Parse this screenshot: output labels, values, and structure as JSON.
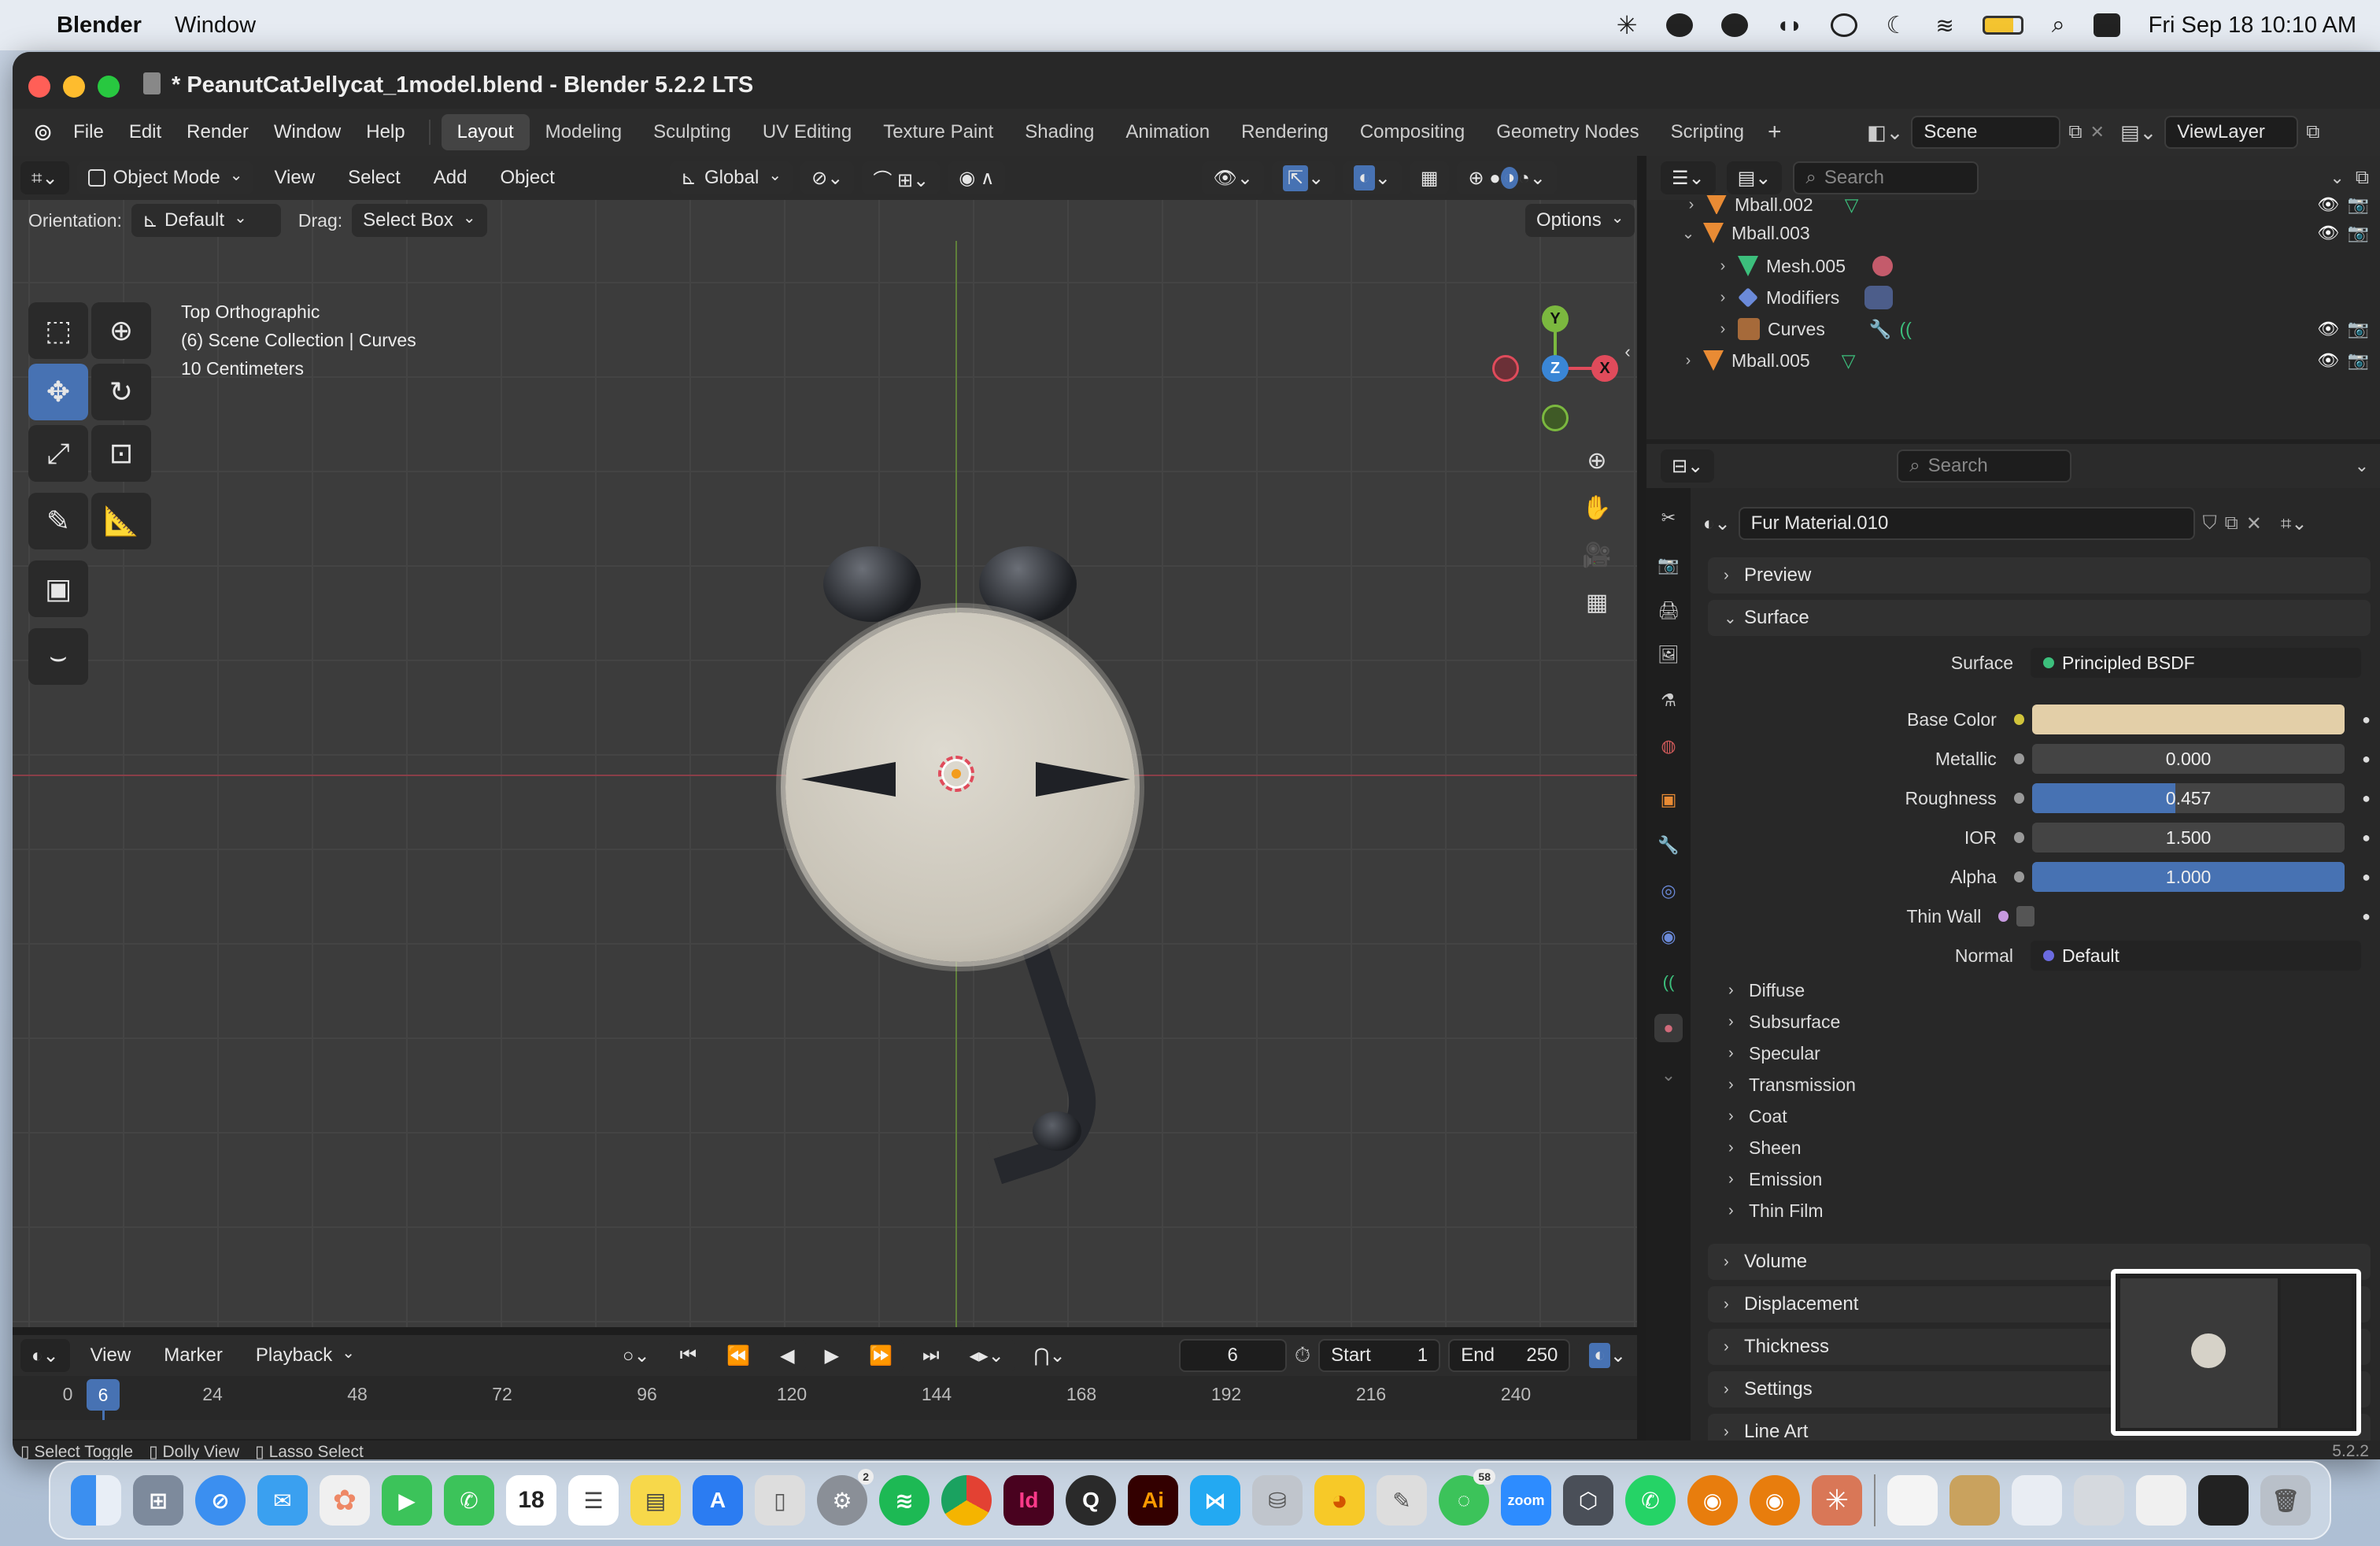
{
  "macos": {
    "app_name": "Blender",
    "menus": [
      "Window"
    ],
    "clock": "Fri Sep 18  10:10 AM"
  },
  "window": {
    "title": "* PeanutCatJellycat_1model.blend - Blender 5.2.2 LTS",
    "menus": [
      "File",
      "Edit",
      "Render",
      "Window",
      "Help"
    ],
    "workspaces": [
      "Layout",
      "Modeling",
      "Sculpting",
      "UV Editing",
      "Texture Paint",
      "Shading",
      "Animation",
      "Rendering",
      "Compositing",
      "Geometry Nodes",
      "Scripting"
    ],
    "active_workspace": "Layout",
    "scene": "Scene",
    "view_layer": "ViewLayer"
  },
  "viewport": {
    "mode": "Object Mode",
    "menus": [
      "View",
      "Select",
      "Add",
      "Object"
    ],
    "transform": "Global",
    "orientation_label": "Orientation:",
    "orientation": "Default",
    "drag_label": "Drag:",
    "drag": "Select Box",
    "options": "Options",
    "overlay_lines": [
      "Top Orthographic",
      "(6) Scene Collection | Curves",
      "10 Centimeters"
    ],
    "gizmo": {
      "y": "Y",
      "z": "Z",
      "x": "X"
    }
  },
  "outliner": {
    "search_placeholder": "Search",
    "rows": [
      {
        "label": "Mball.002",
        "indent": 0
      },
      {
        "label": "Mball.003",
        "indent": 0
      },
      {
        "label": "Mesh.005",
        "indent": 1
      },
      {
        "label": "Modifiers",
        "indent": 1
      },
      {
        "label": "Curves",
        "indent": 1
      },
      {
        "label": "Mball.005",
        "indent": 0
      }
    ]
  },
  "properties": {
    "search_placeholder": "Search",
    "material": "Fur Material.010",
    "panels": {
      "preview": "Preview",
      "surface": "Surface"
    },
    "surface": {
      "label": "Surface",
      "shader": "Principled BSDF"
    },
    "fields": {
      "base_color": {
        "label": "Base Color",
        "color": "#e3cfa8"
      },
      "metallic": {
        "label": "Metallic",
        "value": "0.000",
        "fraction": 0
      },
      "roughness": {
        "label": "Roughness",
        "value": "0.457",
        "fraction": 0.457
      },
      "ior": {
        "label": "IOR",
        "value": "1.500",
        "fraction": 0
      },
      "alpha": {
        "label": "Alpha",
        "value": "1.000",
        "fraction": 1
      },
      "thin_wall": {
        "label": "Thin Wall"
      },
      "normal": {
        "label": "Normal",
        "value": "Default"
      }
    },
    "subpanels": [
      "Diffuse",
      "Subsurface",
      "Specular",
      "Transmission",
      "Coat",
      "Sheen",
      "Emission",
      "Thin Film"
    ],
    "bottom_panels": [
      "Volume",
      "Displacement",
      "Thickness",
      "Settings",
      "Line Art",
      "Viewport Display"
    ]
  },
  "timeline": {
    "menus": [
      "View",
      "Marker",
      "Playback"
    ],
    "current_frame": "6",
    "start_label": "Start",
    "start": "1",
    "end_label": "End",
    "end": "250",
    "ruler": [
      "0",
      "6",
      "24",
      "48",
      "72",
      "96",
      "120",
      "144",
      "168",
      "192",
      "216",
      "240"
    ]
  },
  "status": {
    "items": [
      "Select Toggle",
      "Dolly View",
      "Lasso Select"
    ],
    "version": "5.2.2"
  },
  "dock": {
    "icons": [
      "finder",
      "launchpad",
      "safari",
      "mail",
      "photos",
      "facetime",
      "phone",
      "calendar",
      "reminders",
      "notes",
      "app-store",
      "files",
      "settings",
      "spotify",
      "chrome",
      "indesign",
      "quicktime",
      "illustrator",
      "vscode",
      "disk-utility",
      "cyberduck",
      "script-editor",
      "messages",
      "zoom",
      "package",
      "whatsapp",
      "blender",
      "blender-2",
      "claude",
      "preview",
      "doc-1",
      "doc-2",
      "doc-3",
      "doc-4",
      "screen-recording",
      "trash"
    ],
    "calendar_day": "18",
    "settings_badge": "2",
    "messages_badge": "58",
    "zoom_label": "zoom",
    "id_label": "Id",
    "ai_label": "Ai"
  },
  "colors": {
    "accent": "#4772b3",
    "axis_x": "#e04b5b",
    "axis_y": "#7bb83f",
    "axis_z": "#3a86d6"
  }
}
